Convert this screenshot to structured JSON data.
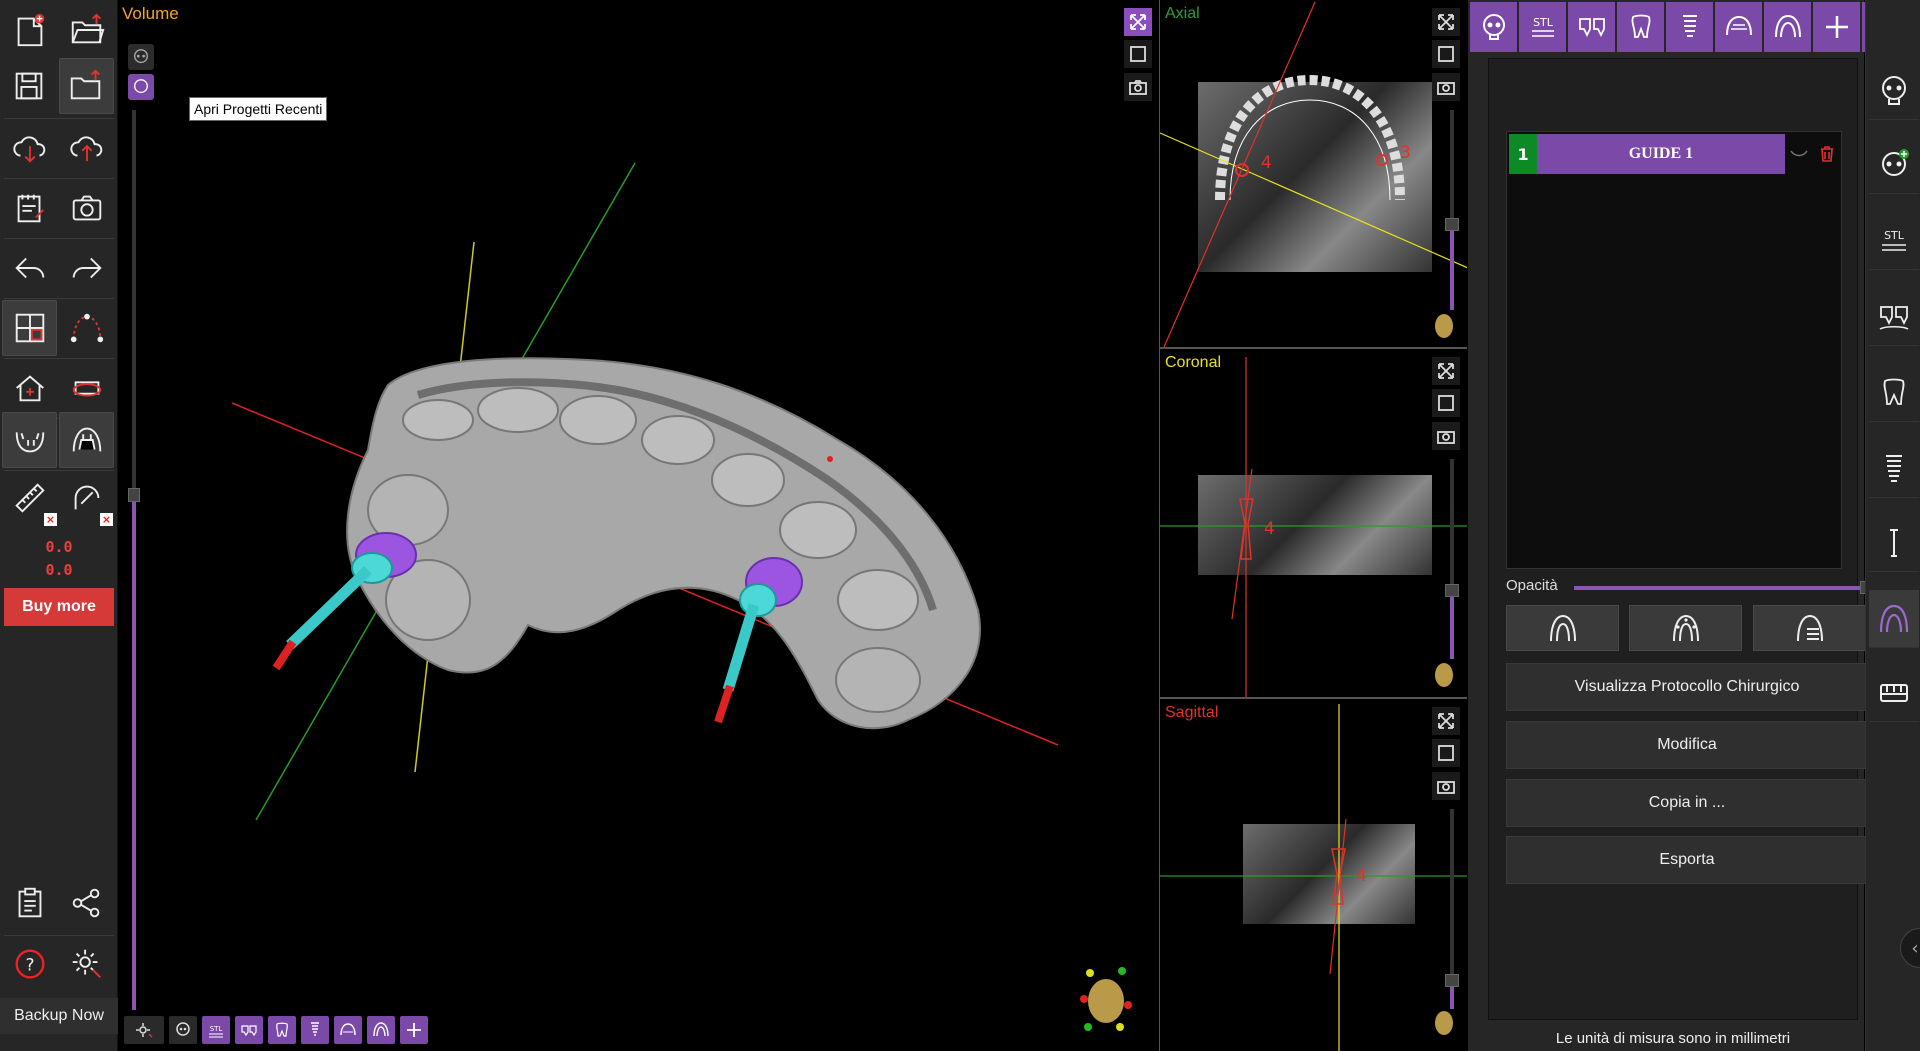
{
  "left_toolbar": {
    "tooltip": "Apri Progetti Recenti",
    "counter_1": "0.0",
    "counter_2": "0.0",
    "buy_more": "Buy more",
    "backup_now": "Backup Now"
  },
  "viewport": {
    "title": "Volume"
  },
  "slices": {
    "axial_title": "Axial",
    "coronal_title": "Coronal",
    "sagittal_title": "Sagittal",
    "implant_label_4": "4",
    "implant_label_3": "3"
  },
  "right_panel": {
    "guide_number": "1",
    "guide_name": "GUIDE 1",
    "opacity_label": "Opacità",
    "actions": {
      "protocol": "Visualizza Protocollo Chirurgico",
      "modify": "Modifica",
      "copy": "Copia in ...",
      "export": "Esporta"
    },
    "units_note": "Le unità di misura sono in millimetri"
  },
  "colors": {
    "accent_purple": "#7b4aa8",
    "buy_red": "#d63a38",
    "volume_orange": "#f5a623",
    "axial_green": "#2e9e3a",
    "coronal_yellow": "#e8e01e",
    "sagittal_red": "#e0322a",
    "guide_green": "#0b8a25"
  },
  "top_tab_icons": [
    "skull-icon",
    "stl-icon",
    "teeth-icon",
    "tooth-icon",
    "implant-icon",
    "arch-icon",
    "guide-icon",
    "plus-icon",
    "list-icon"
  ],
  "side_icons": [
    "skull-icon",
    "skull-add-icon",
    "stl-icon",
    "teeth-icon",
    "tooth-icon",
    "implant-icon",
    "pin-icon",
    "guide-icon",
    "bridge-icon"
  ],
  "stl_text": "STL"
}
